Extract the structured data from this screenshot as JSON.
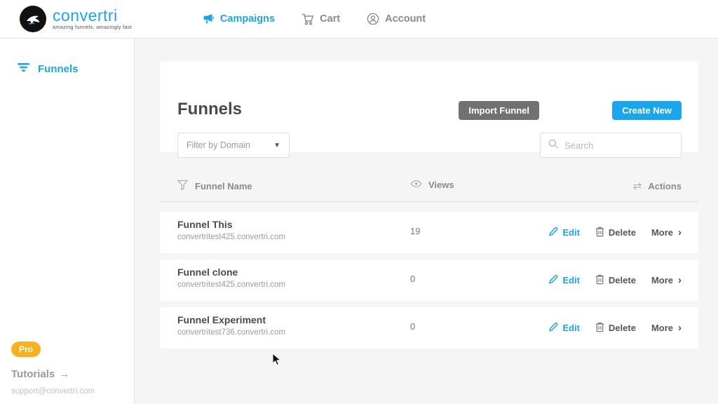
{
  "brand": {
    "name": "convertri",
    "tagline": "amazing funnels, amazingly fast"
  },
  "topnav": {
    "campaigns": "Campaigns",
    "cart": "Cart",
    "account": "Account"
  },
  "sidebar": {
    "funnels": "Funnels",
    "pro_badge": "Pro",
    "tutorials": "Tutorials",
    "tutorials_arrow": "→",
    "support_email": "support@convertri.com"
  },
  "main": {
    "title": "Funnels",
    "import_button": "Import Funnel",
    "create_button": "Create New",
    "filter_placeholder": "Filter by Domain",
    "search_placeholder": "Search",
    "table": {
      "headers": {
        "name": "Funnel Name",
        "views": "Views",
        "actions": "Actions"
      },
      "actions": {
        "edit": "Edit",
        "delete": "Delete",
        "more": "More",
        "more_chevron": "›"
      },
      "rows": [
        {
          "name": "Funnel This",
          "domain": "convertritest425.convertri.com",
          "views": "19"
        },
        {
          "name": "Funnel clone",
          "domain": "convertritest425.convertri.com",
          "views": "0"
        },
        {
          "name": "Funnel Experiment",
          "domain": "convertritest736.convertri.com",
          "views": "0"
        }
      ]
    }
  },
  "colors": {
    "accent_blue": "#1aa6ef",
    "button_gray": "#717171",
    "pro_yellow": "#f6b21b",
    "page_background": "#f5f5f5"
  }
}
